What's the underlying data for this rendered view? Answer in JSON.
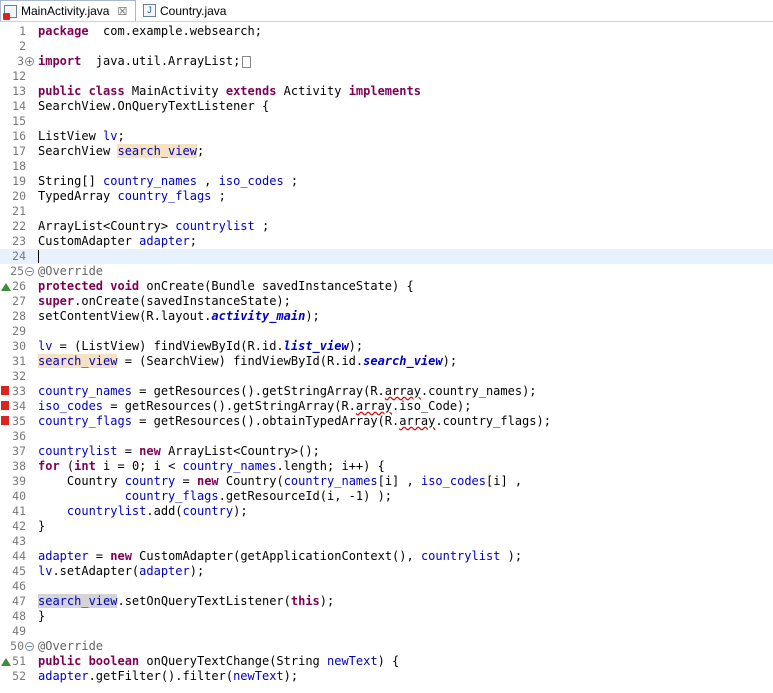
{
  "tabs": [
    {
      "label": "MainActivity.java",
      "close": "☒",
      "icon": "java-error-icon",
      "active": true
    },
    {
      "label": "Country.java",
      "icon": "java-file-icon",
      "active": false
    }
  ],
  "lines": [
    {
      "n": "1",
      "t": [
        [
          "kw",
          "package"
        ],
        [
          "",
          "  com.example.websearch;"
        ]
      ]
    },
    {
      "n": "2",
      "t": []
    },
    {
      "n": "3",
      "t": [
        [
          "kw",
          "import"
        ],
        [
          "",
          "  java.util.ArrayList;"
        ]
      ],
      "fold": "+",
      "box": true
    },
    {
      "n": "12",
      "t": []
    },
    {
      "n": "13",
      "t": [
        [
          "kw",
          "public class"
        ],
        [
          "",
          " MainActivity "
        ],
        [
          "kw",
          "extends"
        ],
        [
          "",
          " Activity "
        ],
        [
          "kw",
          "implements"
        ]
      ]
    },
    {
      "n": "14",
      "t": [
        [
          "",
          "SearchView.OnQueryTextListener {"
        ]
      ]
    },
    {
      "n": "15",
      "t": []
    },
    {
      "n": "16",
      "t": [
        [
          "",
          "ListView "
        ],
        [
          "fld",
          "lv"
        ],
        [
          "",
          ";"
        ]
      ]
    },
    {
      "n": "17",
      "t": [
        [
          "",
          "SearchView "
        ],
        [
          "fld occ",
          "search_view"
        ],
        [
          "",
          ";"
        ]
      ]
    },
    {
      "n": "18",
      "t": []
    },
    {
      "n": "19",
      "t": [
        [
          "",
          "String[] "
        ],
        [
          "fld",
          "country_names"
        ],
        [
          "",
          " , "
        ],
        [
          "fld",
          "iso_codes"
        ],
        [
          "",
          " ;"
        ]
      ]
    },
    {
      "n": "20",
      "t": [
        [
          "",
          "TypedArray "
        ],
        [
          "fld",
          "country_flags"
        ],
        [
          "",
          " ;"
        ]
      ]
    },
    {
      "n": "21",
      "t": []
    },
    {
      "n": "22",
      "t": [
        [
          "",
          "ArrayList<Country> "
        ],
        [
          "fld",
          "countrylist"
        ],
        [
          "",
          " ;"
        ]
      ]
    },
    {
      "n": "23",
      "t": [
        [
          "",
          "CustomAdapter "
        ],
        [
          "fld",
          "adapter"
        ],
        [
          "",
          ";"
        ]
      ]
    },
    {
      "n": "24",
      "t": [],
      "current": true,
      "caret": true
    },
    {
      "n": "25",
      "t": [
        [
          "ann",
          "@Override"
        ]
      ],
      "fold": "−"
    },
    {
      "n": "26",
      "t": [
        [
          "kw",
          "protected void"
        ],
        [
          "",
          " onCreate(Bundle savedInstanceState) {"
        ]
      ],
      "marker": "override"
    },
    {
      "n": "27",
      "t": [
        [
          "kw",
          "super"
        ],
        [
          "",
          ".onCreate(savedInstanceState);"
        ]
      ]
    },
    {
      "n": "28",
      "t": [
        [
          "",
          "setContentView(R.layout."
        ],
        [
          "stf",
          "activity_main"
        ],
        [
          "",
          ");"
        ]
      ]
    },
    {
      "n": "29",
      "t": []
    },
    {
      "n": "30",
      "t": [
        [
          "fld",
          "lv"
        ],
        [
          "",
          " = (ListView) findViewById(R.id."
        ],
        [
          "stf",
          "list_view"
        ],
        [
          "",
          ");"
        ]
      ]
    },
    {
      "n": "31",
      "t": [
        [
          "fld occ",
          "search_view"
        ],
        [
          "",
          " = (SearchView) findViewById(R.id."
        ],
        [
          "stf",
          "search_view"
        ],
        [
          "",
          ");"
        ]
      ]
    },
    {
      "n": "32",
      "t": []
    },
    {
      "n": "33",
      "t": [
        [
          "fld",
          "country_names"
        ],
        [
          "",
          " = getResources().getStringArray(R."
        ],
        [
          "warn",
          "array"
        ],
        [
          "",
          ".country_names);"
        ]
      ],
      "marker": "error"
    },
    {
      "n": "34",
      "t": [
        [
          "fld",
          "iso_codes"
        ],
        [
          "",
          " = getResources().getStringArray(R."
        ],
        [
          "warn",
          "array"
        ],
        [
          "",
          ".iso_Code);"
        ]
      ],
      "marker": "error"
    },
    {
      "n": "35",
      "t": [
        [
          "fld",
          "country_flags"
        ],
        [
          "",
          " = getResources().obtainTypedArray(R."
        ],
        [
          "warn",
          "array"
        ],
        [
          "",
          ".country_flags);"
        ]
      ],
      "marker": "error"
    },
    {
      "n": "36",
      "t": []
    },
    {
      "n": "37",
      "t": [
        [
          "fld",
          "countrylist"
        ],
        [
          "",
          " = "
        ],
        [
          "kw",
          "new"
        ],
        [
          "",
          " ArrayList<Country>();"
        ]
      ]
    },
    {
      "n": "38",
      "t": [
        [
          "kw",
          "for"
        ],
        [
          "",
          " ("
        ],
        [
          "kw",
          "int"
        ],
        [
          "",
          " i = 0; i < "
        ],
        [
          "fld",
          "country_names"
        ],
        [
          "",
          ".length; i++) {"
        ]
      ]
    },
    {
      "n": "39",
      "t": [
        [
          "",
          "    Country "
        ],
        [
          "fld",
          "country"
        ],
        [
          "",
          " = "
        ],
        [
          "kw",
          "new"
        ],
        [
          "",
          " Country("
        ],
        [
          "fld",
          "country_names"
        ],
        [
          "",
          "[i] , "
        ],
        [
          "fld",
          "iso_codes"
        ],
        [
          "",
          "[i] ,"
        ]
      ]
    },
    {
      "n": "40",
      "t": [
        [
          "",
          "            "
        ],
        [
          "fld",
          "country_flags"
        ],
        [
          "",
          ".getResourceId(i, -1) );"
        ]
      ]
    },
    {
      "n": "41",
      "t": [
        [
          "",
          "    "
        ],
        [
          "fld",
          "countrylist"
        ],
        [
          "",
          ".add("
        ],
        [
          "fld",
          "country"
        ],
        [
          "",
          ");"
        ]
      ]
    },
    {
      "n": "42",
      "t": [
        [
          "",
          "}"
        ]
      ]
    },
    {
      "n": "43",
      "t": []
    },
    {
      "n": "44",
      "t": [
        [
          "fld",
          "adapter"
        ],
        [
          "",
          " = "
        ],
        [
          "kw",
          "new"
        ],
        [
          "",
          " CustomAdapter(getApplicationContext(), "
        ],
        [
          "fld",
          "countrylist"
        ],
        [
          "",
          " );"
        ]
      ]
    },
    {
      "n": "45",
      "t": [
        [
          "fld",
          "lv"
        ],
        [
          "",
          ".setAdapter("
        ],
        [
          "fld",
          "adapter"
        ],
        [
          "",
          ");"
        ]
      ]
    },
    {
      "n": "46",
      "t": []
    },
    {
      "n": "47",
      "t": [
        [
          "fld occ2",
          "search_view"
        ],
        [
          "",
          ".setOnQueryTextListener("
        ],
        [
          "kw",
          "this"
        ],
        [
          "",
          ");"
        ]
      ]
    },
    {
      "n": "48",
      "t": [
        [
          "",
          "}"
        ]
      ]
    },
    {
      "n": "49",
      "t": []
    },
    {
      "n": "50",
      "t": [
        [
          "ann",
          "@Override"
        ]
      ],
      "fold": "−"
    },
    {
      "n": "51",
      "t": [
        [
          "kw",
          "public boolean"
        ],
        [
          "",
          " onQueryTextChange(String "
        ],
        [
          "fld",
          "newText"
        ],
        [
          "",
          ") {"
        ]
      ],
      "marker": "override"
    },
    {
      "n": "52",
      "t": [
        [
          "fld",
          "adapter"
        ],
        [
          "",
          ".getFilter().filter("
        ],
        [
          "fld",
          "newText"
        ],
        [
          "",
          ");"
        ]
      ]
    }
  ]
}
